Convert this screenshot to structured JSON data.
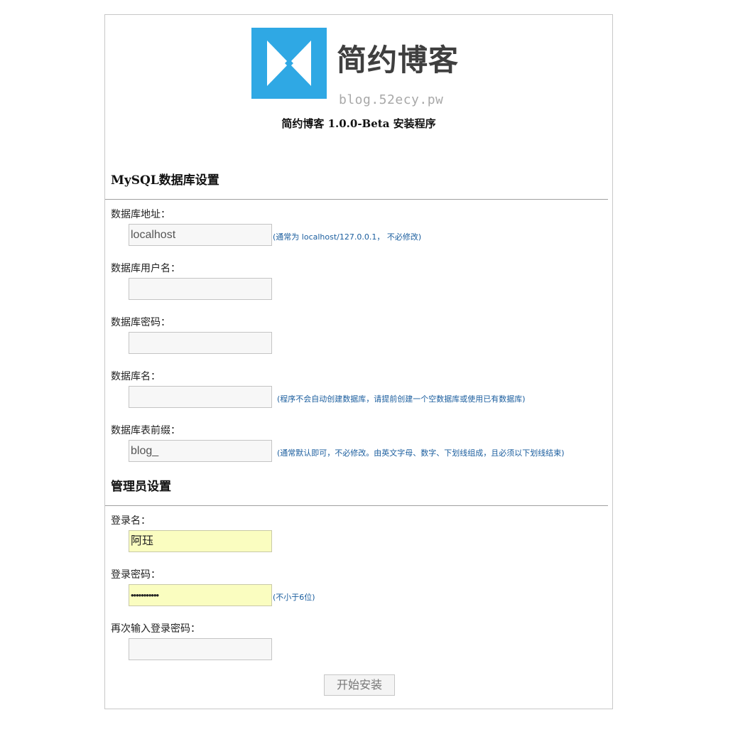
{
  "logo": {
    "title": "简约博客",
    "subtitle": "blog.52ecy.pw",
    "mark_icon": "bowtie-m-logo-icon",
    "brand_color": "#2fa8e4"
  },
  "page_title": "简约博客 1.0.0-Beta 安装程序",
  "mysql_section": {
    "heading": "MySQL数据库设置",
    "fields": [
      {
        "label": "数据库地址：",
        "value": "localhost",
        "hint": "(通常为 localhost/127.0.0.1， 不必修改)"
      },
      {
        "label": "数据库用户名：",
        "value": "",
        "hint": ""
      },
      {
        "label": "数据库密码：",
        "value": "",
        "hint": ""
      },
      {
        "label": "数据库名：",
        "value": "",
        "hint": "(程序不会自动创建数据库，请提前创建一个空数据库或使用已有数据库)"
      },
      {
        "label": "数据库表前缀：",
        "value": "blog_",
        "hint": "(通常默认即可，不必修改。由英文字母、数字、下划线组成，且必须以下划线结束)"
      }
    ]
  },
  "admin_section": {
    "heading": "管理员设置",
    "fields": [
      {
        "label": "登录名：",
        "value": "阿珏",
        "hint": ""
      },
      {
        "label": "登录密码：",
        "value": "•••••••••••",
        "hint": "(不小于6位)"
      },
      {
        "label": "再次输入登录密码：",
        "value": "",
        "hint": ""
      }
    ]
  },
  "submit_label": "开始安装",
  "colors": {
    "hint_text": "#1a5d9e",
    "autofill_bg": "#fafdc0",
    "input_bg": "#f7f7f7",
    "frame_border": "#c8c8c8"
  }
}
